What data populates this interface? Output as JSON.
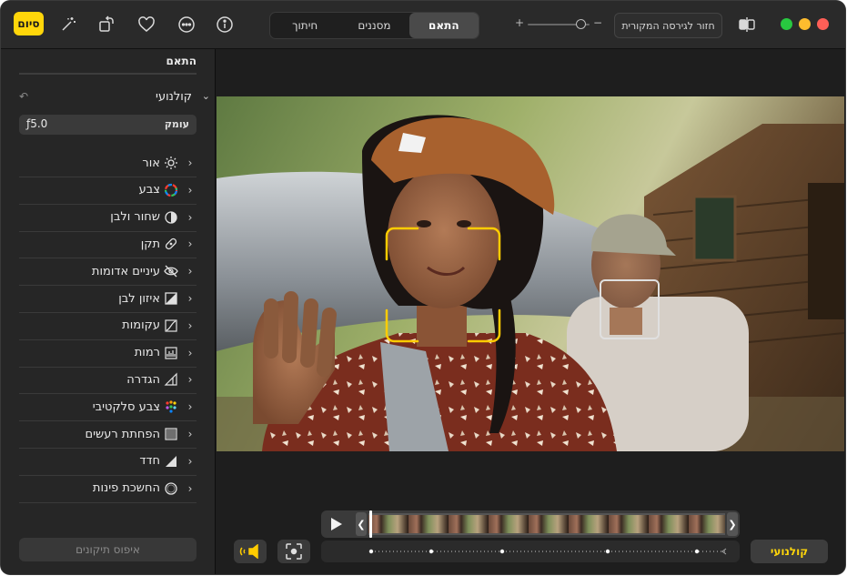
{
  "toolbar": {
    "done_label": "סיום",
    "tabs": [
      {
        "label": "התאם",
        "active": true
      },
      {
        "label": "מסננים",
        "active": false
      },
      {
        "label": "חיתוך",
        "active": false
      }
    ],
    "revert_label": "חזור לגירסה המקורית",
    "zoom_minus": "−",
    "zoom_plus": "+",
    "zoom_level": 0.55,
    "icons": [
      "magic-wand-icon",
      "rotate-icon",
      "heart-icon",
      "more-icon",
      "info-icon",
      "split-view-icon"
    ]
  },
  "sidebar": {
    "title": "התאם",
    "cinematic": {
      "label": "קולנועי",
      "depth_label": "עומק",
      "depth_value": "ƒ5.0"
    },
    "items": [
      {
        "label": "אור",
        "icon": "sun-icon"
      },
      {
        "label": "צבע",
        "icon": "color-circle-icon"
      },
      {
        "label": "שחור ולבן",
        "icon": "half-circle-icon"
      },
      {
        "label": "תקן",
        "icon": "bandage-icon"
      },
      {
        "label": "עיניים אדומות",
        "icon": "eye-icon"
      },
      {
        "label": "איזון לבן",
        "icon": "white-balance-icon"
      },
      {
        "label": "עקומות",
        "icon": "curves-icon"
      },
      {
        "label": "רמות",
        "icon": "levels-icon"
      },
      {
        "label": "הגדרה",
        "icon": "definition-icon"
      },
      {
        "label": "צבע סלקטיבי",
        "icon": "selective-color-icon"
      },
      {
        "label": "הפחתת רעשים",
        "icon": "noise-icon"
      },
      {
        "label": "חדד",
        "icon": "sharpen-icon"
      },
      {
        "label": "החשכת פינות",
        "icon": "vignette-icon"
      }
    ],
    "reset_label": "איפוס תיקונים"
  },
  "bottom": {
    "cinematic_label": "קולנועי"
  },
  "colors": {
    "accent": "#ffd60a",
    "focus_primary": "#ffcc00",
    "focus_secondary": "#e0e0e0"
  }
}
